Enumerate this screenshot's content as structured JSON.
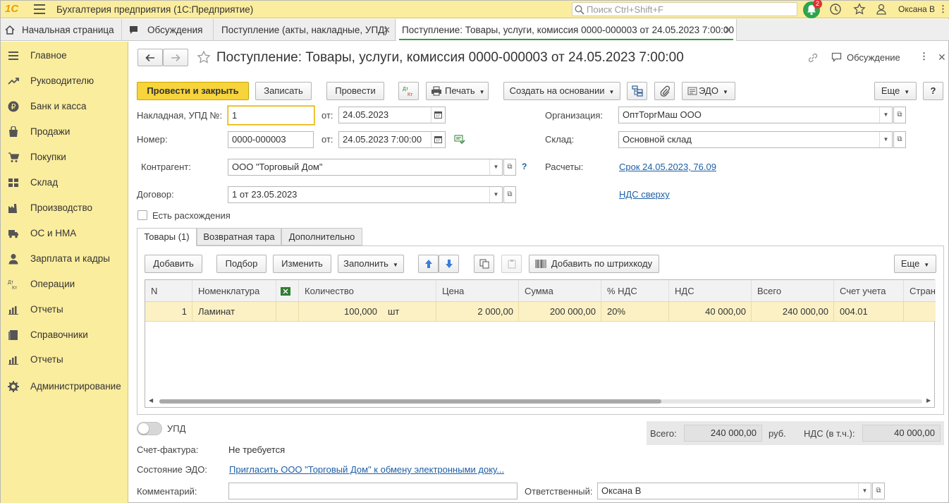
{
  "app": {
    "logo": "1С",
    "title": "Бухгалтерия предприятия  (1С:Предприятие)",
    "search_placeholder": "Поиск Ctrl+Shift+F",
    "notif_count": "2",
    "user": "Оксана В"
  },
  "tabs": [
    {
      "label": "Начальная страница"
    },
    {
      "label": "Обсуждения"
    },
    {
      "label": "Поступление (акты, накладные, УПД)"
    },
    {
      "label": "Поступление: Товары, услуги, комиссия 0000-000003 от 24.05.2023 7:00:00"
    }
  ],
  "sidebar": {
    "items": [
      {
        "label": "Главное",
        "icon": "menu-icon"
      },
      {
        "label": "Руководителю",
        "icon": "trend-icon"
      },
      {
        "label": "Банк и касса",
        "icon": "ruble-icon"
      },
      {
        "label": "Продажи",
        "icon": "bag-icon"
      },
      {
        "label": "Покупки",
        "icon": "cart-icon"
      },
      {
        "label": "Склад",
        "icon": "warehouse-icon"
      },
      {
        "label": "Производство",
        "icon": "factory-icon"
      },
      {
        "label": "ОС и НМА",
        "icon": "truck-icon"
      },
      {
        "label": "Зарплата и кадры",
        "icon": "person-icon"
      },
      {
        "label": "Операции",
        "icon": "dt-kt-icon"
      },
      {
        "label": "Отчеты",
        "icon": "bar-chart-icon"
      },
      {
        "label": "Справочники",
        "icon": "book-icon"
      },
      {
        "label": "Отчеты",
        "icon": "bar-chart-icon"
      },
      {
        "label": "Администрирование",
        "icon": "gear-icon"
      }
    ]
  },
  "doc": {
    "title": "Поступление: Товары, услуги, комиссия 0000-000003 от 24.05.2023 7:00:00",
    "discussion": "Обсуждение"
  },
  "toolbar": {
    "post_close": "Провести и закрыть",
    "save": "Записать",
    "post": "Провести",
    "dtkt": "Дт Кт",
    "print": "Печать",
    "create_based": "Создать на основании",
    "edo": "ЭДО",
    "more": "Еще",
    "help": "?"
  },
  "fields": {
    "invoice_label": "Накладная, УПД №:",
    "invoice_no": "1",
    "from_label": "от:",
    "invoice_date": "24.05.2023",
    "number_label": "Номер:",
    "number": "0000-000003",
    "number_date": "24.05.2023  7:00:00",
    "org_label": "Организация:",
    "org": "ОптТоргМаш ООО",
    "warehouse_label": "Склад:",
    "warehouse": "Основной склад",
    "contractor_label": "Контрагент:",
    "contractor": "ООО \"Торговый Дом\"",
    "settlements_label": "Расчеты:",
    "settlements": "Срок 24.05.2023, 76.09",
    "contract_label": "Договор:",
    "contract": "1 от 23.05.2023",
    "vat_mode": "НДС сверху",
    "discrepancy": "Есть расхождения"
  },
  "subtabs": [
    {
      "label": "Товары (1)"
    },
    {
      "label": "Возвратная тара"
    },
    {
      "label": "Дополнительно"
    }
  ],
  "tabletoolbar": {
    "add": "Добавить",
    "pick": "Подбор",
    "edit": "Изменить",
    "fill": "Заполнить",
    "barcode": "Добавить по штрихкоду",
    "more": "Еще"
  },
  "table": {
    "headers": [
      "N",
      "Номенклатура",
      "",
      "Количество",
      "Цена",
      "Сумма",
      "% НДС",
      "НДС",
      "Всего",
      "Счет учета",
      "Страна"
    ],
    "rows": [
      {
        "n": "1",
        "item": "Ламинат",
        "qty": "100,000",
        "unit": "шт",
        "price": "2 000,00",
        "sum": "200 000,00",
        "vat_rate": "20%",
        "vat": "40 000,00",
        "total": "240 000,00",
        "account": "004.01"
      }
    ]
  },
  "footer": {
    "upd_label": "УПД",
    "total_label": "Всего:",
    "total": "240 000,00",
    "currency": "руб.",
    "vat_label": "НДС (в т.ч.):",
    "vat": "40 000,00",
    "invoice_label": "Счет-фактура:",
    "invoice_value": "Не требуется",
    "edo_label": "Состояние ЭДО:",
    "edo_link": "Пригласить ООО \"Торговый Дом\" к обмену электронными доку...",
    "comment_label": "Комментарий:",
    "comment": "",
    "responsible_label": "Ответственный:",
    "responsible": "Оксана В"
  },
  "colors": {
    "accent_yellow": "#f7d43b",
    "panel_yellow": "#fbed9e",
    "row_highlight": "#fbf1c5",
    "link": "#1d5fa6"
  }
}
